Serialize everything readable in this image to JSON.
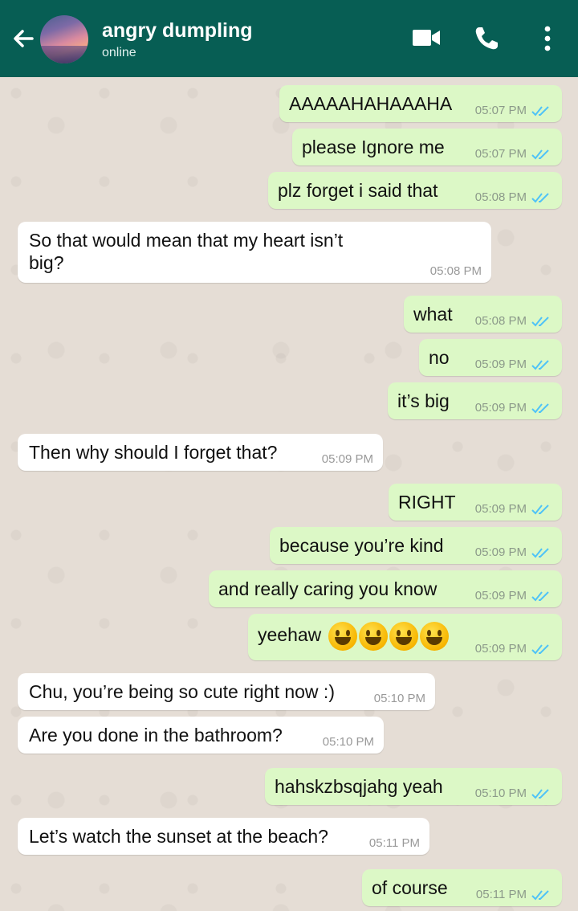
{
  "header": {
    "contact_name": "angry dumpling",
    "status": "online",
    "icons": [
      "back-arrow-icon",
      "video-call-icon",
      "voice-call-icon",
      "more-options-icon"
    ],
    "color": "#075e54"
  },
  "colors": {
    "outgoing": "#dcf8c6",
    "incoming": "#ffffff",
    "ticks": "#4fc3f7",
    "background": "#e5ddd5"
  },
  "messages": [
    {
      "dir": "out",
      "text": "AAAAAHAHAAAHA",
      "time": "05:07 PM"
    },
    {
      "dir": "out",
      "text": "please Ignore me",
      "time": "05:07 PM"
    },
    {
      "dir": "out",
      "text": "plz forget i said that",
      "time": "05:08 PM"
    },
    {
      "dir": "in",
      "text_line1": "So that would mean that my heart isn’t",
      "text_line2": "big?",
      "time": "05:08 PM"
    },
    {
      "dir": "out",
      "text": "what",
      "time": "05:08 PM"
    },
    {
      "dir": "out",
      "text": "no",
      "time": "05:09 PM"
    },
    {
      "dir": "out",
      "text": "it’s big",
      "time": "05:09 PM"
    },
    {
      "dir": "in",
      "text": "Then why should I forget that?",
      "time": "05:09 PM"
    },
    {
      "dir": "out",
      "text": "RIGHT",
      "time": "05:09 PM"
    },
    {
      "dir": "out",
      "text": "because you’re kind",
      "time": "05:09 PM"
    },
    {
      "dir": "out",
      "text": "and really caring you know",
      "time": "05:09 PM"
    },
    {
      "dir": "out",
      "text": "yeehaw",
      "emoji": "😀😀😀😀",
      "time": "05:09 PM"
    },
    {
      "dir": "in",
      "text": "Chu, you’re being so cute right now :)",
      "time": "05:10 PM"
    },
    {
      "dir": "in",
      "text": "Are you done in the bathroom?",
      "time": "05:10 PM"
    },
    {
      "dir": "out",
      "text": "hahskzbsqjahg yeah",
      "time": "05:10 PM"
    },
    {
      "dir": "in",
      "text": "Let’s watch the sunset at the beach?",
      "time": "05:11 PM"
    },
    {
      "dir": "out",
      "text": "of course",
      "time": "05:11 PM"
    }
  ]
}
